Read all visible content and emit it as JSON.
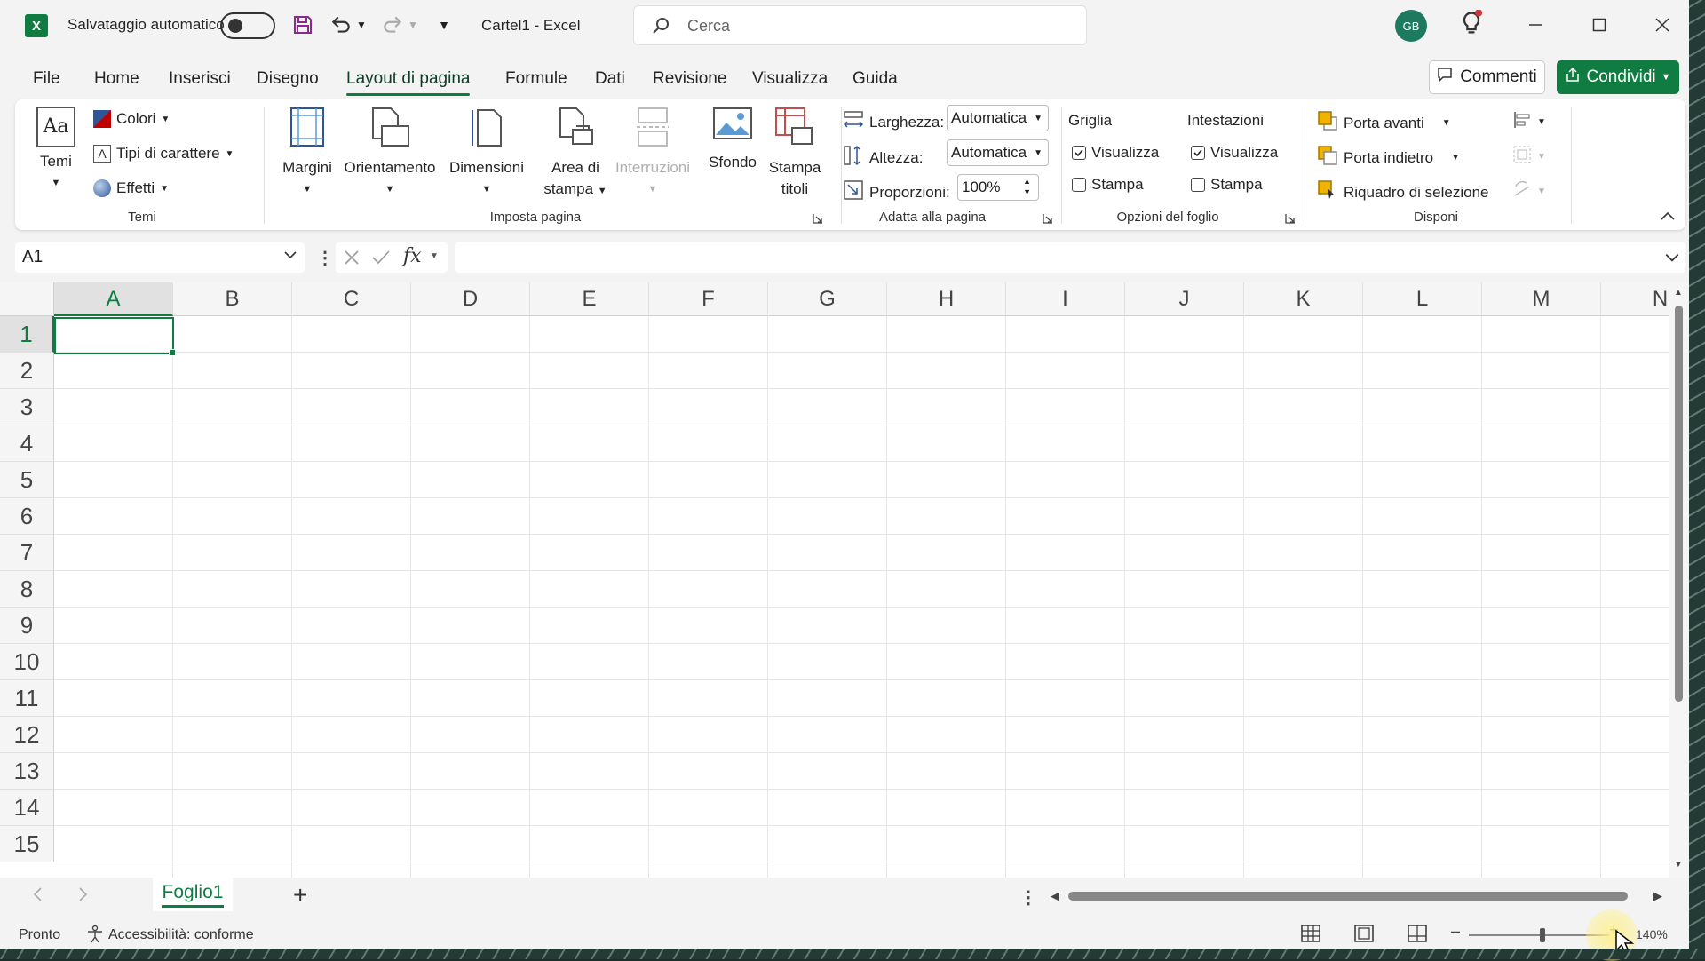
{
  "titlebar": {
    "autosave_label": "Salvataggio automatico",
    "doc_title": "Cartel1  -  Excel",
    "search_placeholder": "Cerca",
    "avatar_initials": "GB",
    "app_logo": "X"
  },
  "tabs": [
    "File",
    "Home",
    "Inserisci",
    "Disegno",
    "Layout di pagina",
    "Formule",
    "Dati",
    "Revisione",
    "Visualizza",
    "Guida"
  ],
  "active_tab": "Layout di pagina",
  "actions": {
    "comments": "Commenti",
    "share": "Condividi"
  },
  "ribbon": {
    "temi": {
      "label": "Temi",
      "themes_btn": "Temi",
      "colors": "Colori",
      "fonts": "Tipi di carattere",
      "effects": "Effetti"
    },
    "imposta_pagina": {
      "label": "Imposta pagina",
      "margins": "Margini",
      "orientation": "Orientamento",
      "size": "Dimensioni",
      "print_area_1": "Area di",
      "print_area_2": "stampa",
      "breaks": "Interruzioni",
      "background": "Sfondo",
      "print_titles_1": "Stampa",
      "print_titles_2": "titoli"
    },
    "adatta": {
      "label": "Adatta alla pagina",
      "width_label": "Larghezza:",
      "width_value": "Automatica",
      "height_label": "Altezza:",
      "height_value": "Automatica",
      "scale_label": "Proporzioni:",
      "scale_value": "100%"
    },
    "opzioni": {
      "label": "Opzioni del foglio",
      "gridlines": "Griglia",
      "headings": "Intestazioni",
      "view": "Visualizza",
      "print": "Stampa",
      "gridlines_view_checked": true,
      "gridlines_print_checked": false,
      "headings_view_checked": true,
      "headings_print_checked": false
    },
    "disponi": {
      "label": "Disponi",
      "bring_forward": "Porta avanti",
      "send_backward": "Porta indietro",
      "selection_pane": "Riquadro di selezione"
    }
  },
  "formula_bar": {
    "name_box": "A1",
    "fx": "fx",
    "formula": ""
  },
  "grid": {
    "columns": [
      "A",
      "B",
      "C",
      "D",
      "E",
      "F",
      "G",
      "H",
      "I",
      "J",
      "K",
      "L",
      "M",
      "N"
    ],
    "rows": [
      "1",
      "2",
      "3",
      "4",
      "5",
      "6",
      "7",
      "8",
      "9",
      "10",
      "11",
      "12",
      "13",
      "14",
      "15"
    ],
    "selected_cell": "A1"
  },
  "sheets": {
    "tabs": [
      "Foglio1"
    ],
    "add": "+"
  },
  "status": {
    "ready": "Pronto",
    "accessibility": "Accessibilità: conforme",
    "zoom": "140%"
  },
  "colors": {
    "accent": "#107c41"
  }
}
